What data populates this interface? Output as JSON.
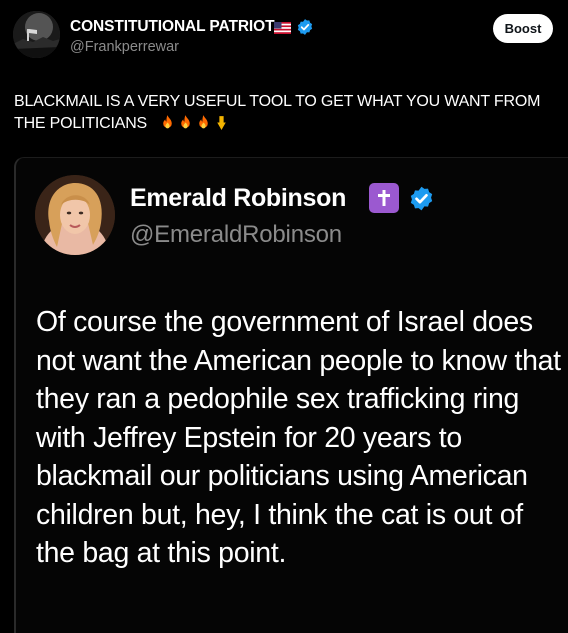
{
  "post": {
    "author_name": "CONSTITUTIONAL PATRIOT",
    "author_handle": "@Frankperrewar",
    "boost_label": "Boost",
    "text": "BLACKMAIL IS A VERY USEFUL TOOL TO GET WHAT YOU WANT FROM THE POLITICIANS",
    "emoji": [
      "fire-emoji",
      "fire-emoji",
      "fire-emoji",
      "pointing-down-emoji"
    ],
    "badges": [
      "us-flag-icon",
      "verified-icon"
    ]
  },
  "quote": {
    "author_name": "Emerald Robinson",
    "author_handle": "@EmeraldRobinson",
    "badges": [
      "latin-cross-icon",
      "verified-icon"
    ],
    "text": "Of course the government of Israel does not want the American people to know that they ran a pedophile sex trafficking ring with Jeffrey Epstein for 20 years to blackmail our politicians using American children but, hey, I think the cat is out of the bag at this point."
  },
  "colors": {
    "background": "#000000",
    "text": "#ffffff",
    "handle": "#8b8b8b",
    "verified": "#1d9bf0",
    "cross_badge": "#9b59d0"
  }
}
